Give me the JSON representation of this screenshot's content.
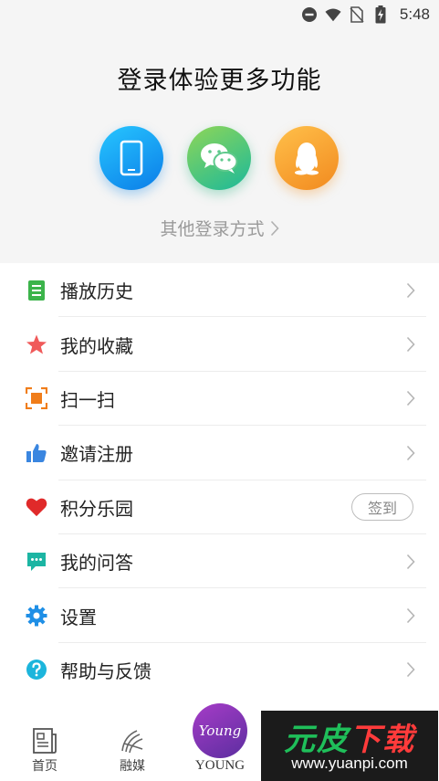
{
  "status_bar": {
    "time": "5:48",
    "icons": [
      "do-not-disturb-icon",
      "wifi-icon",
      "no-sim-icon",
      "battery-charging-icon"
    ]
  },
  "login": {
    "title": "登录体验更多功能",
    "methods": [
      {
        "name": "phone",
        "icon": "phone-icon"
      },
      {
        "name": "wechat",
        "icon": "wechat-icon"
      },
      {
        "name": "qq",
        "icon": "qq-icon"
      }
    ],
    "other_login": "其他登录方式"
  },
  "menu": {
    "items": [
      {
        "label": "播放历史",
        "icon": "history-icon",
        "color": "#3cb44b"
      },
      {
        "label": "我的收藏",
        "icon": "star-icon",
        "color": "#f05a5a"
      },
      {
        "label": "扫一扫",
        "icon": "scan-icon",
        "color": "#f07d1a"
      },
      {
        "label": "邀请注册",
        "icon": "thumbs-up-icon",
        "color": "#3a86e0"
      },
      {
        "label": "积分乐园",
        "icon": "heart-icon",
        "color": "#e02a2a",
        "action": "签到"
      },
      {
        "label": "我的问答",
        "icon": "chat-icon",
        "color": "#1cb5a3"
      },
      {
        "label": "设置",
        "icon": "gear-icon",
        "color": "#1f8fe6"
      },
      {
        "label": "帮助与反馈",
        "icon": "help-icon",
        "color": "#1cb5dc"
      }
    ]
  },
  "tabbar": {
    "tabs": [
      {
        "label": "首页",
        "icon": "newspaper-icon"
      },
      {
        "label": "融媒",
        "icon": "media-icon"
      },
      {
        "label": "YOUNG",
        "icon": "young-logo",
        "logo_text": "Young"
      }
    ]
  },
  "watermark": {
    "text_main": "元皮",
    "text_accent": "下载",
    "url": "www.yuanpi.com"
  },
  "colors": {
    "background": "#f5f5f5",
    "phone_gradient": "#0b7de8",
    "wechat_gradient": "#1bb99a",
    "qq_gradient": "#f28a1f",
    "young_purple": "#7a2fb5"
  }
}
